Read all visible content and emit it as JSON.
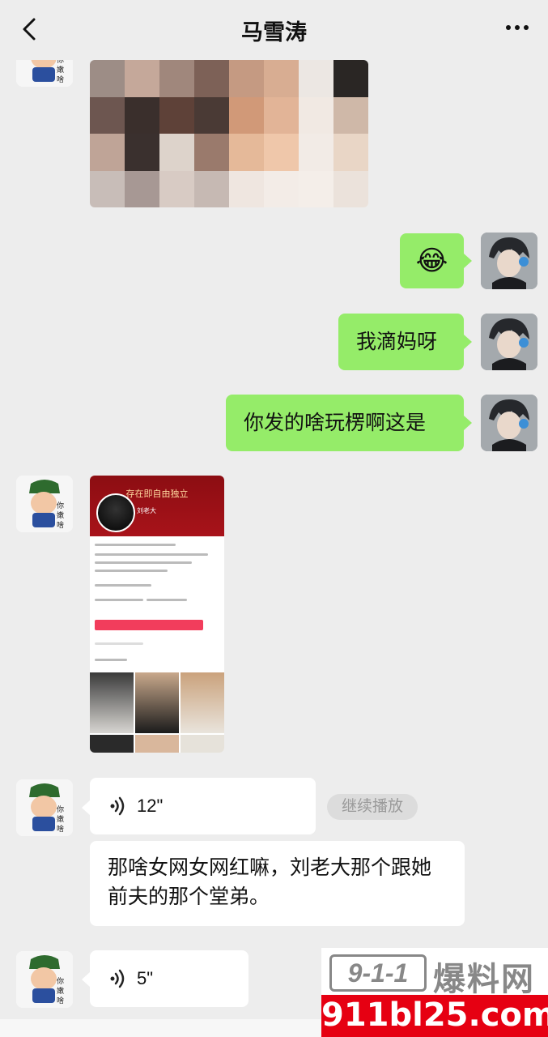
{
  "header": {
    "title": "马雪涛"
  },
  "messages": {
    "m1": {
      "type": "image",
      "description_kind": "mosaic"
    },
    "m2": {
      "type": "emoji",
      "text": "😂"
    },
    "m3": {
      "type": "text",
      "text": "我滴妈呀"
    },
    "m4": {
      "type": "text",
      "text": "你发的啥玩楞啊这是"
    },
    "m5": {
      "type": "image",
      "screenshot": {
        "banner": "存在即自由独立",
        "profile_name": "刘老大"
      }
    },
    "m6": {
      "type": "voice",
      "duration": "12\"",
      "action": "继续播放"
    },
    "m7": {
      "type": "text",
      "text": "那啥女网女网红嘛，刘老大那个跟她前夫的那个堂弟。"
    },
    "m8": {
      "type": "voice",
      "duration": "5\""
    }
  },
  "watermark": {
    "logo": "9-1-1",
    "name": "爆料网",
    "url": "911bl25.com"
  },
  "colors": {
    "bg": "#ededed",
    "green_bubble": "#95ec69",
    "white_bubble": "#ffffff",
    "watermark_red": "#e60012"
  },
  "icons": [
    "back-icon",
    "more-icon",
    "voice-icon"
  ]
}
